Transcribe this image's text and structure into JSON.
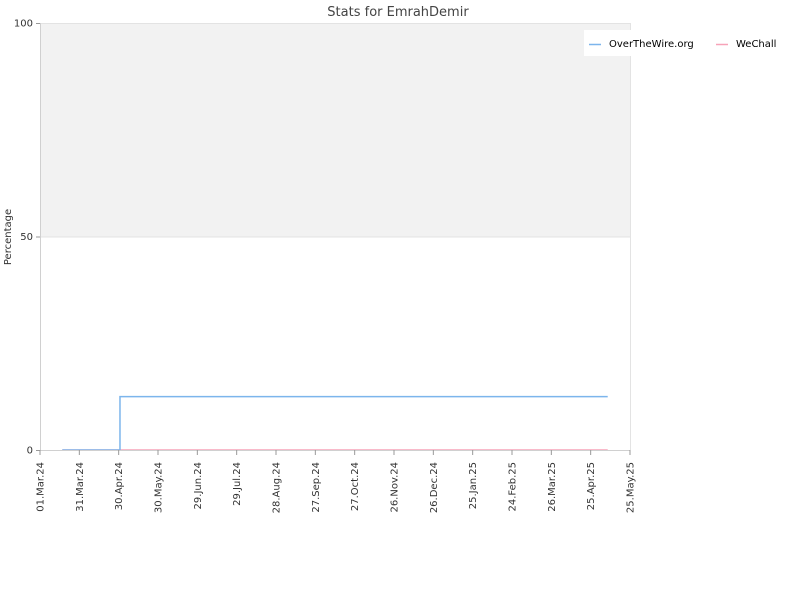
{
  "chart_data": {
    "type": "line",
    "title": "Stats for EmrahDemir",
    "xlabel": "",
    "ylabel": "Percentage",
    "ylim": [
      0,
      100
    ],
    "yticks": [
      "0",
      "50",
      "100"
    ],
    "x_axis_range": [
      "2024-03-01",
      "2025-05-25"
    ],
    "xticks": [
      {
        "date": "2024-03-01",
        "label": "01.Mar.24"
      },
      {
        "date": "2024-03-31",
        "label": "31.Mar.24"
      },
      {
        "date": "2024-04-30",
        "label": "30.Apr.24"
      },
      {
        "date": "2024-05-30",
        "label": "30.May.24"
      },
      {
        "date": "2024-06-29",
        "label": "29.Jun.24"
      },
      {
        "date": "2024-07-29",
        "label": "29.Jul.24"
      },
      {
        "date": "2024-08-28",
        "label": "28.Aug.24"
      },
      {
        "date": "2024-09-27",
        "label": "27.Sep.24"
      },
      {
        "date": "2024-10-27",
        "label": "27.Oct.24"
      },
      {
        "date": "2024-11-26",
        "label": "26.Nov.24"
      },
      {
        "date": "2024-12-26",
        "label": "26.Dec.24"
      },
      {
        "date": "2025-01-25",
        "label": "25.Jan.25"
      },
      {
        "date": "2025-02-24",
        "label": "24.Feb.25"
      },
      {
        "date": "2025-03-26",
        "label": "26.Mar.25"
      },
      {
        "date": "2025-04-25",
        "label": "25.Apr.25"
      },
      {
        "date": "2025-05-25",
        "label": "25.May.25"
      }
    ],
    "grid": true,
    "legend_position": "top-right",
    "background_band": {
      "from": 50,
      "to": 100,
      "color": "#f2f2f2"
    },
    "series": [
      {
        "name": "OverTheWire.org",
        "color": "#7cb5ec",
        "step": true,
        "points": [
          {
            "x": "2024-03-18",
            "y": 0
          },
          {
            "x": "2024-04-30",
            "y": 0
          },
          {
            "x": "2024-05-01",
            "y": 12.5
          },
          {
            "x": "2025-05-08",
            "y": 12.5
          }
        ]
      },
      {
        "name": "WeChall",
        "color": "#f7a3b8",
        "step": false,
        "points": [
          {
            "x": "2024-03-18",
            "y": 0
          },
          {
            "x": "2025-05-08",
            "y": 0
          }
        ]
      }
    ]
  }
}
